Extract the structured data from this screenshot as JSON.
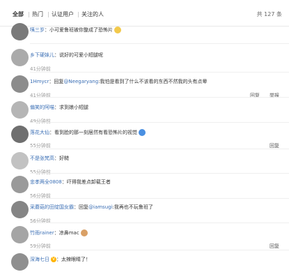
{
  "tabs": [
    {
      "label": "全部"
    },
    {
      "label": "热门"
    },
    {
      "label": "认证用户"
    },
    {
      "label": "关注的人"
    }
  ],
  "total_count": "共 127 条",
  "actions": {
    "reply": "回复",
    "report": "举报"
  },
  "comments": [
    {
      "name": "咦三岁",
      "sep": "：",
      "text": "小可爱鲁班被你整成了恐怖片",
      "time": "",
      "emoji": "laughing-emoji"
    },
    {
      "name": "乡下硬妹儿",
      "sep": "：",
      "text": "说好的可爱小短腿呢",
      "time": "41分钟前"
    },
    {
      "name": "1Hmycr",
      "sep": "：",
      "prefix": "回复",
      "mention": "@Neegaryang",
      "text": ":我怕是看到了什么不该看的东西不然我的头有点晕",
      "time": "41分钟前"
    },
    {
      "name": "偏笑的阿喵",
      "sep": "：",
      "text": "求到娘小短腿",
      "time": "49分钟前"
    },
    {
      "name": "落花大仙",
      "sep": "：",
      "text": "看到脸的那一刻居然有看恐怖片的视觉",
      "time": "55分钟前",
      "emoji": "shocked-emoji"
    },
    {
      "name": "不是张梵高",
      "sep": "：",
      "text": "好糙",
      "time": "55分钟前"
    },
    {
      "name": "忠孝两全0808",
      "sep": "：",
      "text": "吓得我差点卸载王者",
      "time": "56分钟前"
    },
    {
      "name": "采蘑菇的田绽国女霸",
      "sep": "：",
      "prefix": "回复",
      "mention": "@iamsugi",
      "text": ":我再也不玩鲁班了",
      "time": "56分钟前"
    },
    {
      "name": "竹雨rainer",
      "sep": "：",
      "text": "凉鼻mac",
      "time": "59分钟前",
      "emoji": "cat-emoji"
    },
    {
      "name": "深海七日",
      "sep": "：",
      "text": "太辣眼睛了！",
      "time": "",
      "badge": true
    }
  ],
  "colors": {
    "name": "#3b6fb5",
    "time": "#9a9a9a",
    "divider": "#efefef"
  }
}
